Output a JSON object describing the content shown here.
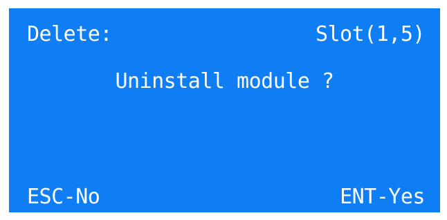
{
  "header": {
    "action": "Delete:",
    "slot": "Slot(1,5)"
  },
  "prompt": "Uninstall module ?",
  "footer": {
    "esc_label": "ESC-No",
    "ent_label": "ENT-Yes"
  },
  "colors": {
    "screen_background": "#0f7ef4",
    "text": "#ffffff",
    "frame": "#ffffff"
  }
}
